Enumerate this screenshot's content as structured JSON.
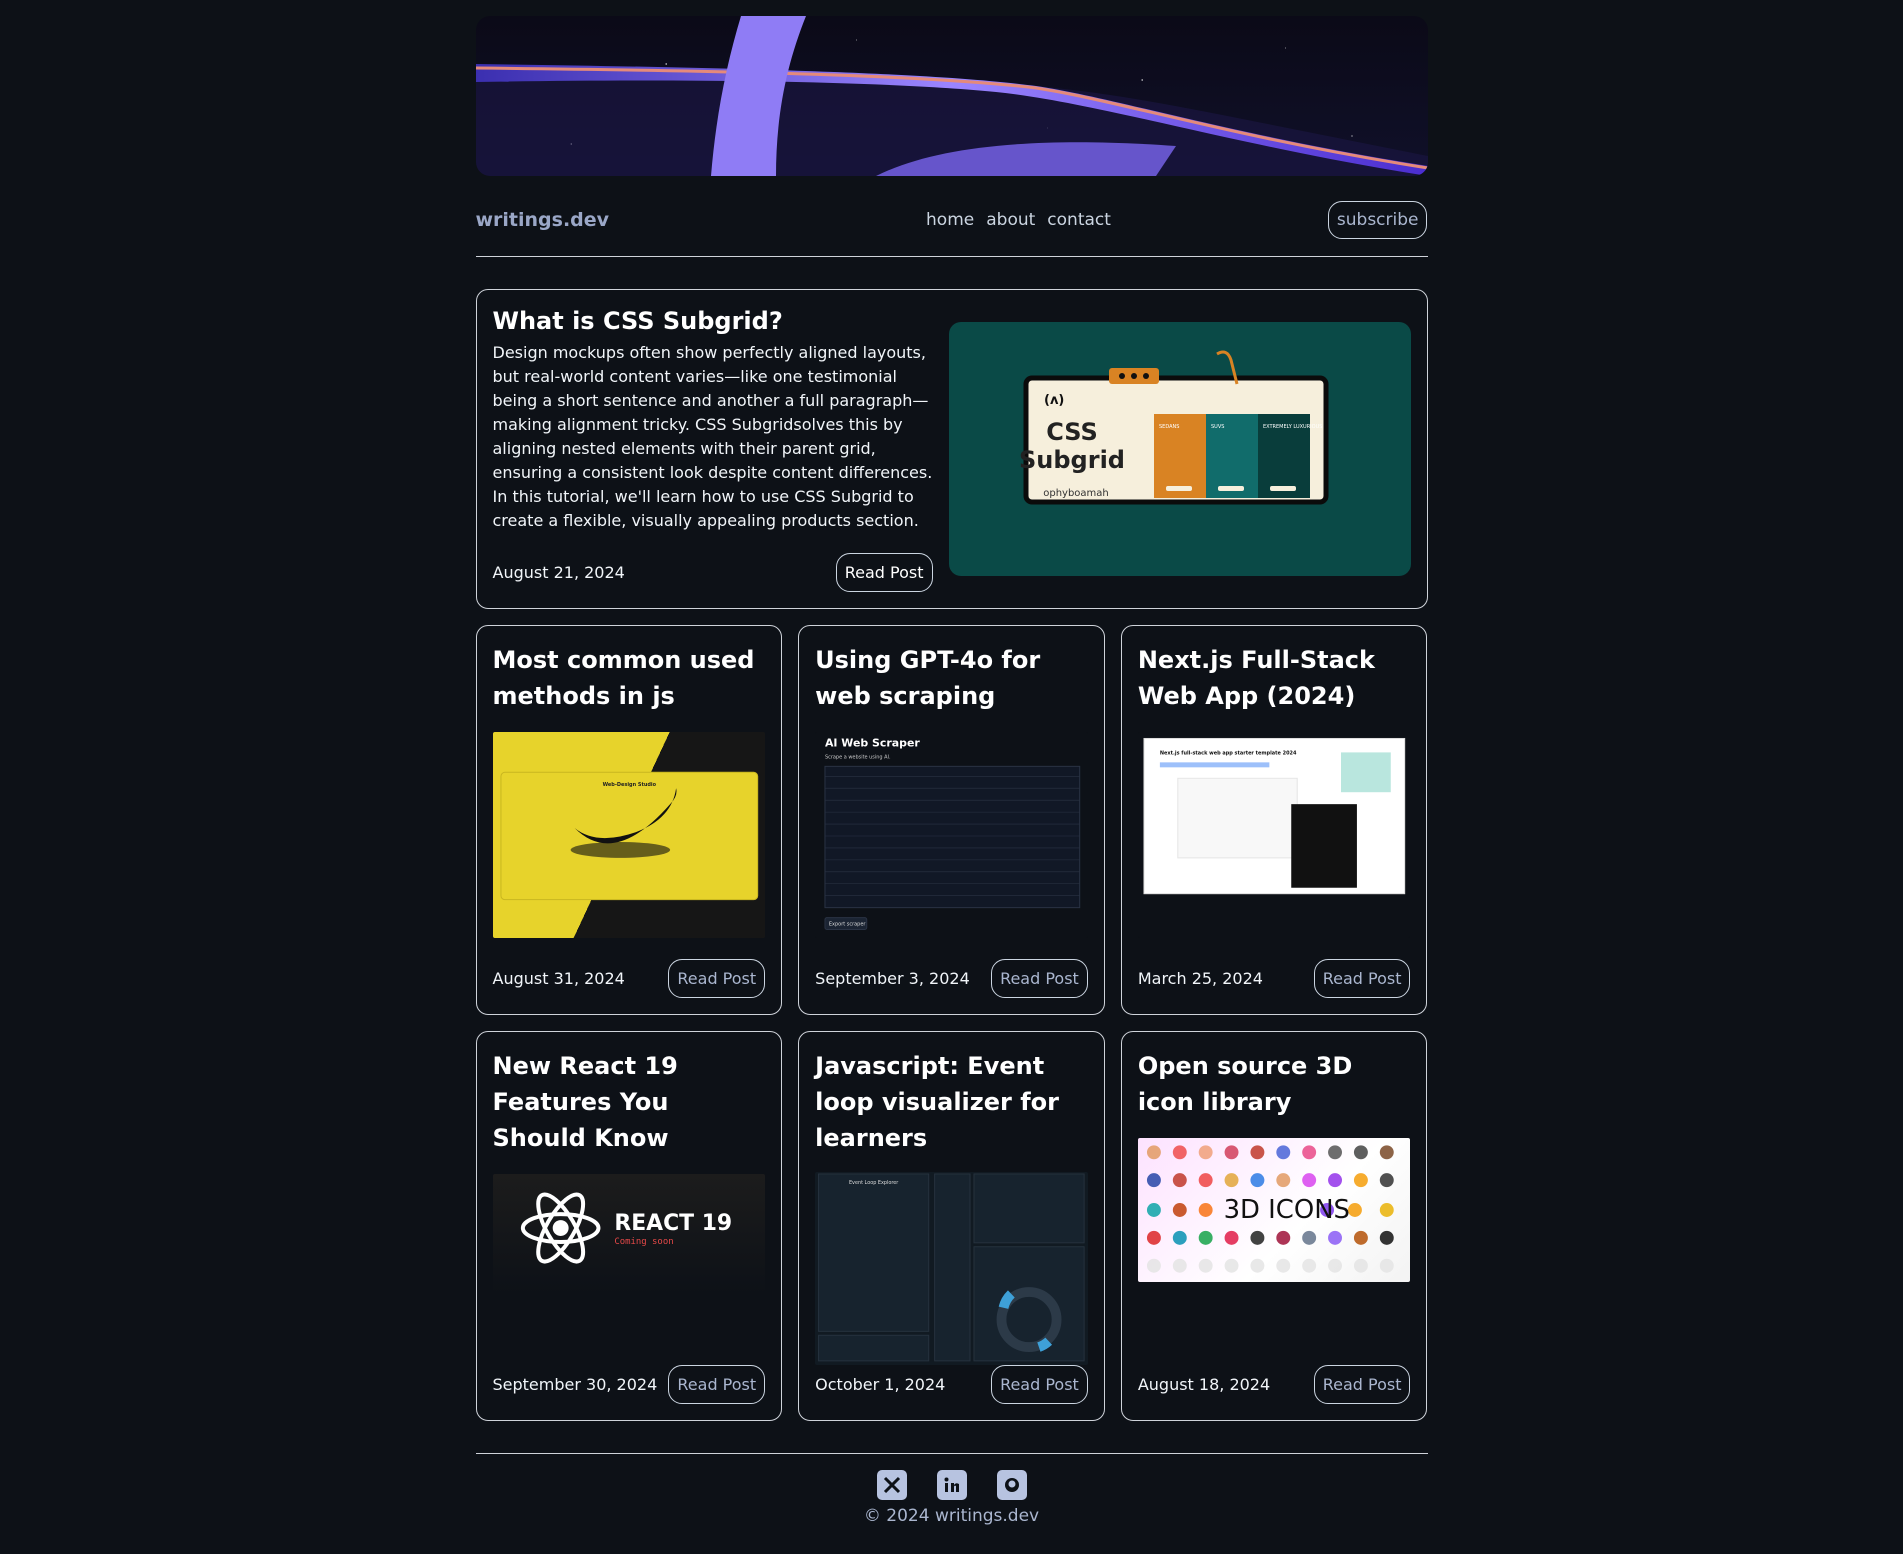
{
  "site": {
    "brand": "writings.dev",
    "nav": [
      "home",
      "about",
      "contact"
    ],
    "subscribe_label": "subscribe"
  },
  "featured": {
    "title": "What is CSS Subgrid?",
    "excerpt": "Design mockups often show perfectly aligned layouts, but real-world content varies—like one testimonial being a short sentence and another a full paragraph—making alignment tricky. CSS Subgridsolves this by aligning nested elements with their parent grid, ensuring a consistent look despite content differences. In this tutorial, we'll learn how to use CSS Subgrid to create a flexible, visually appealing products section.",
    "date": "August 21, 2024",
    "read_label": "Read Post",
    "image": {
      "title_line1": "CSS",
      "title_line2": "Subgrid",
      "author": "ophyboamah",
      "col1": "SEDANS",
      "col2": "SUVS",
      "col3": "EXTREMELY LUXURIOUS"
    }
  },
  "posts": [
    {
      "title": "Most common used methods in js",
      "date": "August 31, 2024",
      "read_label": "Read Post",
      "thumb": {
        "caption": "Web-Design Studio"
      }
    },
    {
      "title": "Using GPT-4o for web scraping",
      "date": "September 3, 2024",
      "read_label": "Read Post",
      "thumb": {
        "heading": "AI Web Scraper",
        "sub": "Scrape a website using AI.",
        "button": "Export scraper"
      }
    },
    {
      "title": "Next.js Full-Stack Web App (2024)",
      "date": "March 25, 2024",
      "read_label": "Read Post",
      "thumb": {
        "heading": "Next.js full-stack web app starter template 2024"
      }
    },
    {
      "title": "New React 19 Features You Should Know",
      "date": "September 30, 2024",
      "read_label": "Read Post",
      "thumb": {
        "heading": "REACT 19",
        "sub": "Coming soon"
      }
    },
    {
      "title": "Javascript: Event loop visualizer for learners",
      "date": "October 1, 2024",
      "read_label": "Read Post",
      "thumb": {
        "heading": "Event Loop Explorer"
      }
    },
    {
      "title": "Open source 3D icon library",
      "date": "August 18, 2024",
      "read_label": "Read Post",
      "thumb": {
        "heading": "3D ICONS"
      }
    }
  ],
  "footer": {
    "socials": [
      "x-icon",
      "linkedin-icon",
      "github-icon"
    ],
    "copyright": "© 2024 writings.dev"
  },
  "colors": {
    "background": "#0d1117",
    "border": "#cfd3da",
    "brand": "#9aa7c7",
    "featured_media": "#0a4a47"
  }
}
